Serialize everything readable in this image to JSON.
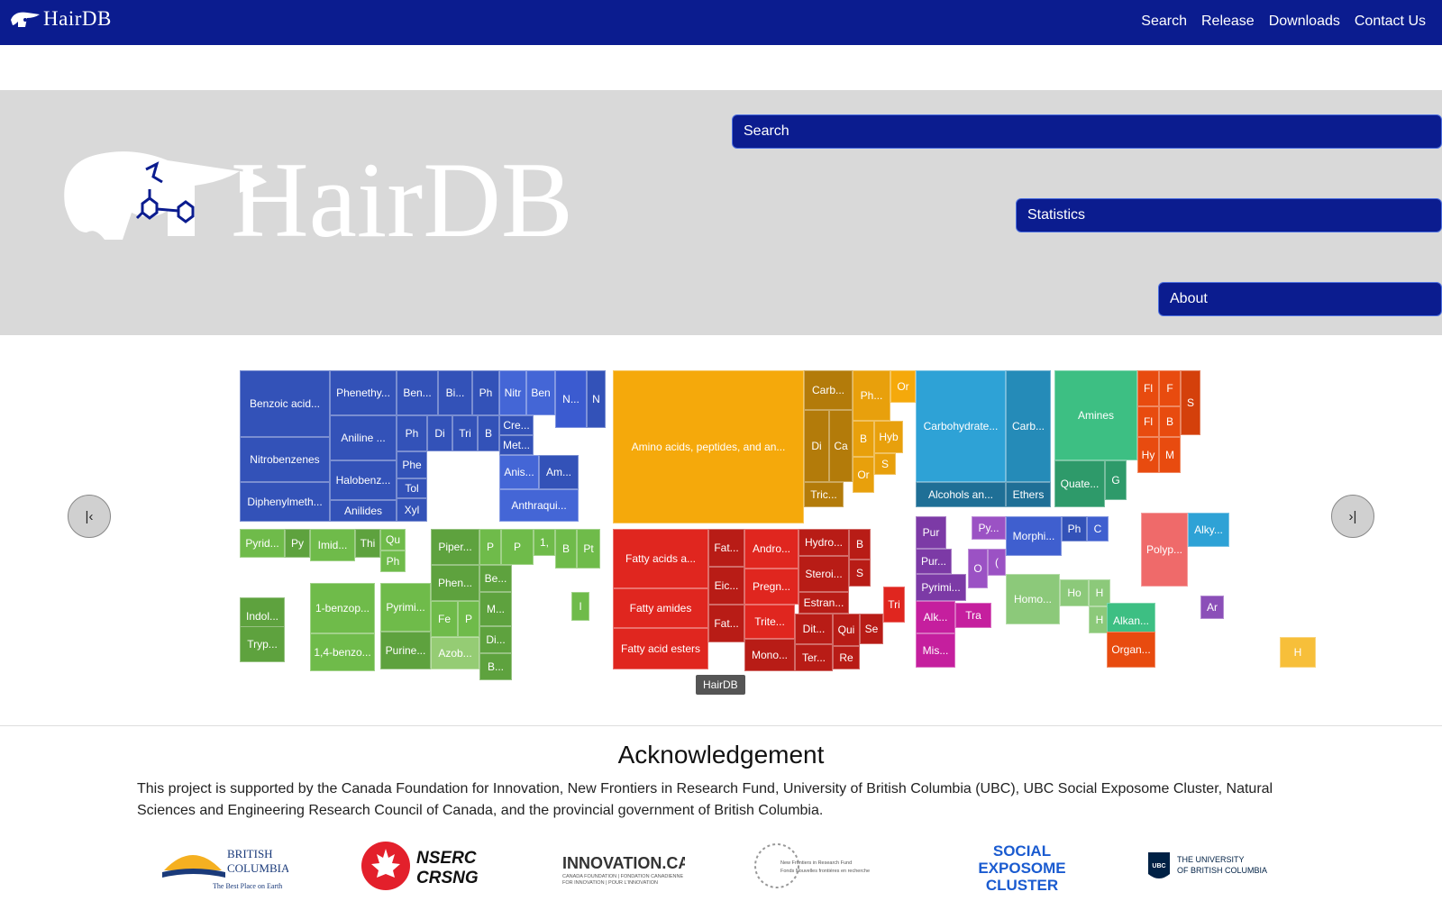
{
  "nav": {
    "brand": "HairDB",
    "links": [
      "Search",
      "Release",
      "Downloads",
      "Contact Us"
    ]
  },
  "hero": {
    "logo_text": "HairDB",
    "buttons": [
      "Search",
      "Statistics",
      "About"
    ]
  },
  "carousel": {
    "caption": "HairDB",
    "prev_icon": "skip-back-icon",
    "next_icon": "skip-forward-icon"
  },
  "treemap": {
    "cells": [
      [
        "Benzoic acid...",
        "#3352b8"
      ],
      [
        "Phenethy...",
        "#3352b8"
      ],
      [
        "Ben...",
        "#3352b8"
      ],
      [
        "Bi...",
        "#3352b8"
      ],
      [
        "Ph",
        "#3352b8"
      ],
      [
        "Nitr",
        "#4466d6"
      ],
      [
        "Ben",
        "#4466d6"
      ],
      [
        "N...",
        "#3b5bd0"
      ],
      [
        "N",
        "#3352b8"
      ],
      [
        "Aniline ...",
        "#3352b8"
      ],
      [
        "Ph",
        "#3352b8"
      ],
      [
        "Di",
        "#3352b8"
      ],
      [
        "Tri",
        "#3352b8"
      ],
      [
        "B",
        "#3352b8"
      ],
      [
        "Cre...",
        "#3352b8"
      ],
      [
        "Met...",
        "#3352b8"
      ],
      [
        "Nitrobenzenes",
        "#3352b8"
      ],
      [
        "Halobenz...",
        "#3352b8"
      ],
      [
        "Phe",
        "#3352b8"
      ],
      [
        "Anis...",
        "#4466d6"
      ],
      [
        "Am...",
        "#3352b8"
      ],
      [
        "Tol",
        "#3352b8"
      ],
      [
        "Diphenylmeth...",
        "#3352b8"
      ],
      [
        "Anilides",
        "#3352b8"
      ],
      [
        "Xyl",
        "#3352b8"
      ],
      [
        "Anthraqui...",
        "#4466d6"
      ],
      [
        "Amino acids, peptides, and an...",
        "#f5a90b"
      ],
      [
        "Carb...",
        "#b37b0a"
      ],
      [
        "Ph...",
        "#e8a00c"
      ],
      [
        "Or",
        "#f5a90b"
      ],
      [
        "Di",
        "#b37b0a"
      ],
      [
        "Ca",
        "#b37b0a"
      ],
      [
        "B",
        "#e8a00c"
      ],
      [
        "Hyb",
        "#e8a00c"
      ],
      [
        "S",
        "#e8a00c"
      ],
      [
        "Or",
        "#e8a00c"
      ],
      [
        "Tric...",
        "#b37b0a"
      ],
      [
        "Carbohydrate...",
        "#2ea2d6"
      ],
      [
        "Carb...",
        "#258bb8"
      ],
      [
        "Alcohols an...",
        "#1f6f96"
      ],
      [
        "Ethers",
        "#1f6f96"
      ],
      [
        "Amines",
        "#3dbf83"
      ],
      [
        "Quate...",
        "#2e9a6a"
      ],
      [
        "G",
        "#2e9a6a"
      ],
      [
        "Fl",
        "#e84b0f"
      ],
      [
        "F",
        "#e84b0f"
      ],
      [
        "S",
        "#d4400b"
      ],
      [
        "Fl",
        "#e84b0f"
      ],
      [
        "B",
        "#e84b0f"
      ],
      [
        "Hy",
        "#e84b0f"
      ],
      [
        "M",
        "#e84b0f"
      ],
      [
        "Pyrid...",
        "#6fbb4a"
      ],
      [
        "Py",
        "#5ea23e"
      ],
      [
        "Imid...",
        "#6fbb4a"
      ],
      [
        "Thi",
        "#5ea23e"
      ],
      [
        "Qu",
        "#6fbb4a"
      ],
      [
        "Piper...",
        "#5ea23e"
      ],
      [
        "P",
        "#6fbb4a"
      ],
      [
        "P",
        "#6fbb4a"
      ],
      [
        "1,",
        "#6fbb4a"
      ],
      [
        "B",
        "#6fbb4a"
      ],
      [
        "Pt",
        "#6fbb4a"
      ],
      [
        "Ph",
        "#6fbb4a"
      ],
      [
        "Phen...",
        "#5ea23e"
      ],
      [
        "Be...",
        "#5ea23e"
      ],
      [
        "Indol...",
        "#5ea23e"
      ],
      [
        "1-benzop...",
        "#6fbb4a"
      ],
      [
        "Pyrimi...",
        "#6fbb4a"
      ],
      [
        "Fe",
        "#6fbb4a"
      ],
      [
        "P",
        "#6fbb4a"
      ],
      [
        "M...",
        "#5ea23e"
      ],
      [
        "I",
        "#6fbb4a"
      ],
      [
        "Tryp...",
        "#5ea23e"
      ],
      [
        "Di...",
        "#5ea23e"
      ],
      [
        "1,4-benzo...",
        "#6fbb4a"
      ],
      [
        "Purine...",
        "#5ea23e"
      ],
      [
        "Azob...",
        "#95cc74"
      ],
      [
        "B...",
        "#5ea23e"
      ],
      [
        "Fatty acids a...",
        "#e0261f"
      ],
      [
        "Fat...",
        "#b81c16"
      ],
      [
        "Andro...",
        "#e0261f"
      ],
      [
        "Hydro...",
        "#b81c16"
      ],
      [
        "B",
        "#b81c16"
      ],
      [
        "Eic...",
        "#b81c16"
      ],
      [
        "Pregn...",
        "#e0261f"
      ],
      [
        "Steroi...",
        "#b81c16"
      ],
      [
        "S",
        "#b81c16"
      ],
      [
        "Estran...",
        "#b81c16"
      ],
      [
        "Tri",
        "#e0261f"
      ],
      [
        "Fatty amides",
        "#e0261f"
      ],
      [
        "Fat...",
        "#b81c16"
      ],
      [
        "Trite...",
        "#e0261f"
      ],
      [
        "Dit...",
        "#b81c16"
      ],
      [
        "Qui",
        "#b81c16"
      ],
      [
        "Se",
        "#b81c16"
      ],
      [
        "Fatty acid esters",
        "#e0261f"
      ],
      [
        "Mono...",
        "#b81c16"
      ],
      [
        "Ter...",
        "#b81c16"
      ],
      [
        "Re",
        "#b81c16"
      ],
      [
        "Pur",
        "#7c3aa6"
      ],
      [
        "Py...",
        "#9b52c4"
      ],
      [
        "Morphi...",
        "#3f5fcf"
      ],
      [
        "Ph",
        "#3352b8"
      ],
      [
        "C",
        "#3f5fcf"
      ],
      [
        "Polyp...",
        "#ef6a6a"
      ],
      [
        "Alky...",
        "#2ea2d6"
      ],
      [
        "Pur...",
        "#7c3aa6"
      ],
      [
        "O",
        "#9b52c4"
      ],
      [
        "(",
        "#9b52c4"
      ],
      [
        "Pyrimi...",
        "#7c3aa6"
      ],
      [
        "Homo...",
        "#8cc97a"
      ],
      [
        "Ho",
        "#8cc97a"
      ],
      [
        "H",
        "#8cc97a"
      ],
      [
        "H",
        "#8cc97a"
      ],
      [
        "Alkan...",
        "#3dbf83"
      ],
      [
        "Ar",
        "#8b4fb8"
      ],
      [
        "Alk...",
        "#c51f9e"
      ],
      [
        "Tra",
        "#c51f9e"
      ],
      [
        "Mis...",
        "#c51f9e"
      ],
      [
        "H",
        "#f7bf3a"
      ],
      [
        "Organ...",
        "#e84b0f"
      ]
    ]
  },
  "acknowledgement": {
    "title": "Acknowledgement",
    "text": "This project is supported by the Canada Foundation for Innovation, New Frontiers in Research Fund, University of British Columbia (UBC), UBC Social Exposome Cluster, Natural Sciences and Engineering Research Council of Canada, and the provincial government of British Columbia."
  },
  "sponsors": {
    "bc_line1": "BRITISH",
    "bc_line2": "COLUMBIA",
    "bc_tagline": "The Best Place on Earth",
    "nserc_line1": "NSERC",
    "nserc_line2": "CRSNG",
    "innovation": "INNOVATION.CA",
    "innovation_sub": "CANADA FOUNDATION | FONDATION CANADIENNE",
    "innovation_sub2": "FOR INNOVATION | POUR L'INNOVATION",
    "nfrf_line1": "New Frontiers in Research Fund",
    "nfrf_line2": "Fonds Nouvelles frontières en recherche",
    "sec_line1": "SOCIAL",
    "sec_line2": "EXPOSOME",
    "sec_line3": "CLUSTER",
    "ubc_short": "UBC",
    "ubc_line1": "THE UNIVERSITY",
    "ubc_line2": "OF BRITISH COLUMBIA"
  }
}
